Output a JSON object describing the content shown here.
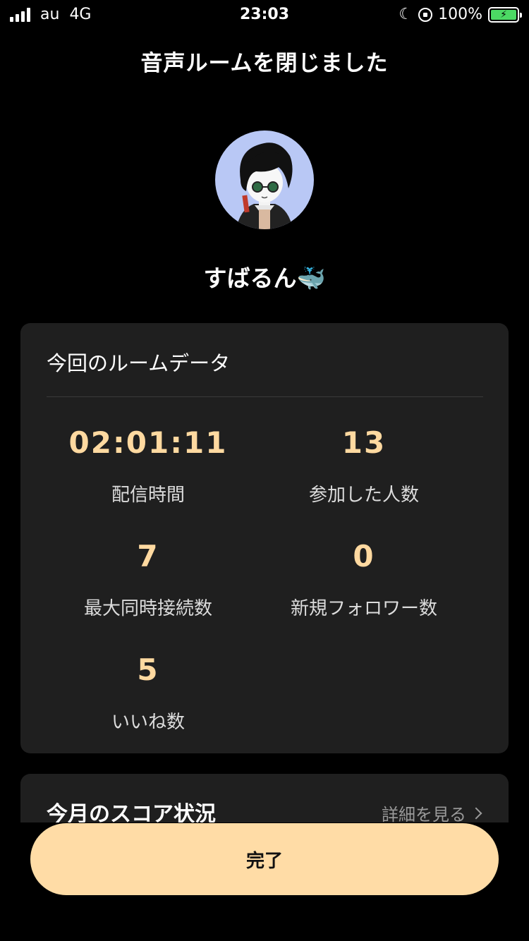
{
  "status_bar": {
    "carrier": "au",
    "network": "4G",
    "time": "23:03",
    "battery": "100%"
  },
  "header": {
    "title": "音声ルームを閉じました"
  },
  "profile": {
    "name": "すばるん🐳"
  },
  "room_data": {
    "title": "今回のルームデータ",
    "stats": [
      {
        "value": "02:01:11",
        "label": "配信時間"
      },
      {
        "value": "13",
        "label": "参加した人数"
      },
      {
        "value": "7",
        "label": "最大同時接続数"
      },
      {
        "value": "0",
        "label": "新規フォロワー数"
      },
      {
        "value": "5",
        "label": "いいね数"
      }
    ]
  },
  "score": {
    "title": "今月のスコア状況",
    "link": "詳細を見る"
  },
  "actions": {
    "done": "完了"
  },
  "colors": {
    "accent": "#ffdca6",
    "stat_value": "#ffd9a0",
    "card_bg": "#1f1f1f",
    "avatar_bg": "#b9c8f5"
  }
}
